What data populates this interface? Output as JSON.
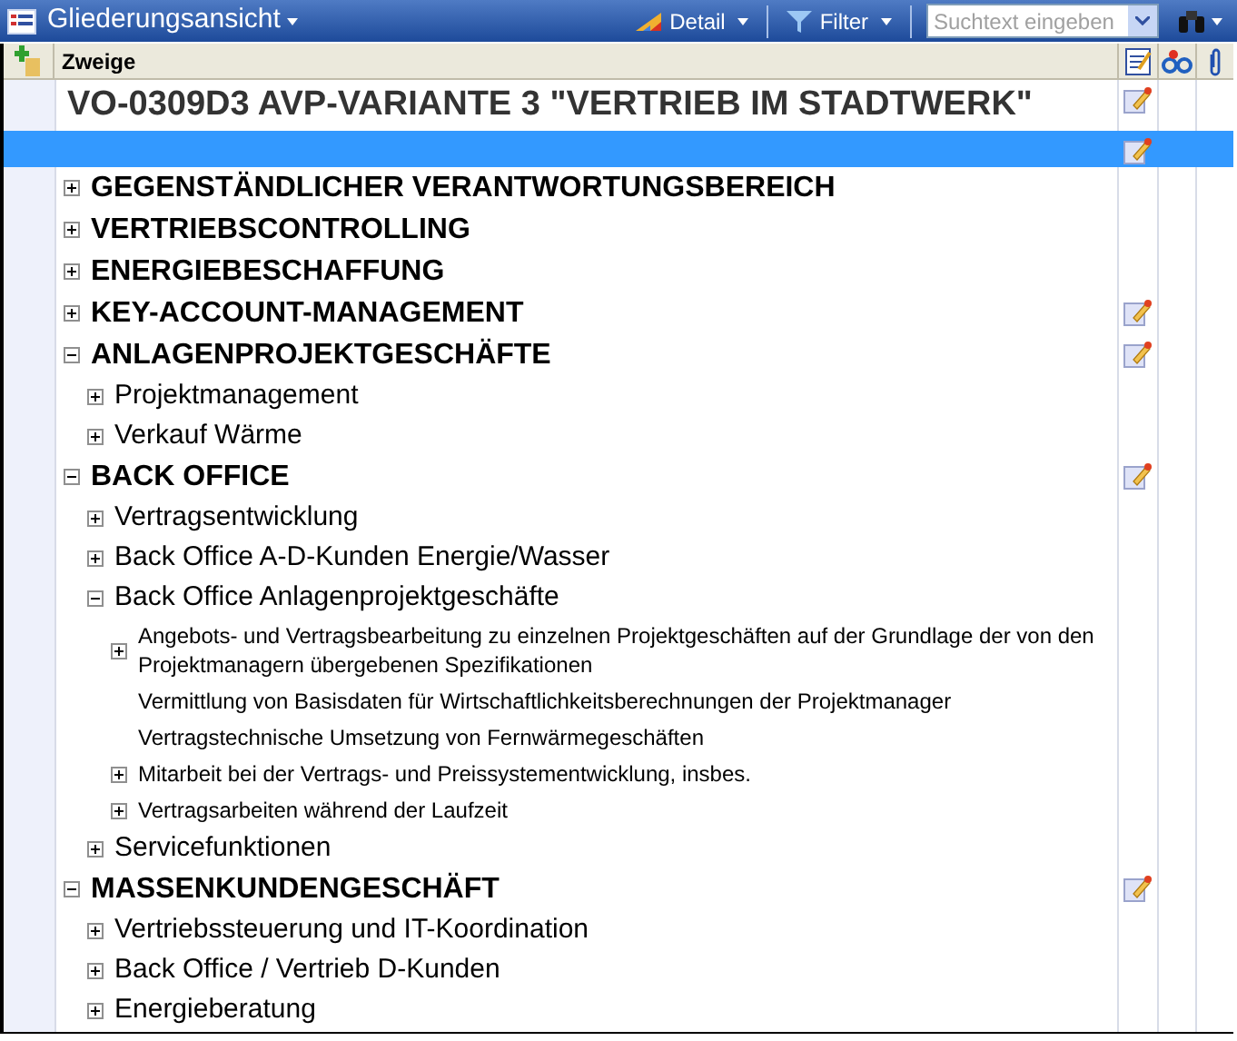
{
  "toolbar": {
    "title": "Gliederungsansicht",
    "detail": "Detail",
    "filter": "Filter",
    "search": {
      "placeholder": "Suchtext eingeben"
    }
  },
  "header": {
    "column": "Zweige"
  },
  "rows": [
    {
      "kind": "title",
      "text": "VO-0309D3 AVP-VARIANTE 3 \"VERTRIEB IM STADTWERK\"",
      "selected": false,
      "has_note": true
    },
    {
      "kind": "blank",
      "selected": true,
      "has_note": true
    }
  ],
  "tree": [
    {
      "kind": "branch",
      "text": "GEGENSTÄNDLICHER VERANTWORTUNGSBEREICH",
      "expanded": false,
      "has_note": false
    },
    {
      "kind": "branch",
      "text": "VERTRIEBSCONTROLLING",
      "expanded": false,
      "has_note": false
    },
    {
      "kind": "branch",
      "text": "ENERGIEBESCHAFFUNG",
      "expanded": false,
      "has_note": false
    },
    {
      "kind": "branch",
      "text": "KEY-ACCOUNT-MANAGEMENT",
      "expanded": false,
      "has_note": true
    },
    {
      "kind": "branch",
      "text": "ANLAGENPROJEKTGESCHÄFTE",
      "expanded": true,
      "has_note": true,
      "children": [
        {
          "kind": "branch",
          "text": "Projektmanagement",
          "expanded": false,
          "has_note": false
        },
        {
          "kind": "branch",
          "text": "Verkauf Wärme",
          "expanded": false,
          "has_note": false
        }
      ]
    },
    {
      "kind": "branch",
      "text": "BACK OFFICE",
      "expanded": true,
      "has_note": true,
      "children": [
        {
          "kind": "branch",
          "text": "Vertragsentwicklung",
          "expanded": false,
          "has_note": false
        },
        {
          "kind": "branch",
          "text": "Back Office A-D-Kunden Energie/Wasser",
          "expanded": false,
          "has_note": false
        },
        {
          "kind": "branch",
          "text": "Back Office Anlagenprojektgeschäfte",
          "expanded": true,
          "has_note": false,
          "children": [
            {
              "kind": "branch",
              "text": "Angebots- und Vertragsbearbeitung zu einzelnen Projektgeschäften auf der Grundlage der von den Projektmanagern übergebenen Spezifikationen",
              "expanded": false,
              "has_note": false
            },
            {
              "kind": "leaf",
              "text": "Vermittlung von Basisdaten für Wirtschaftlichkeitsberechnungen der Projektmanager",
              "has_note": false
            },
            {
              "kind": "leaf",
              "text": "Vertragstechnische Umsetzung von Fernwärmegeschäften",
              "has_note": false
            },
            {
              "kind": "branch",
              "text": "Mitarbeit bei der Vertrags- und Preissystementwicklung, insbes.",
              "expanded": false,
              "has_note": false
            },
            {
              "kind": "branch",
              "text": "Vertragsarbeiten während der Laufzeit",
              "expanded": false,
              "has_note": false
            }
          ]
        },
        {
          "kind": "branch",
          "text": "Servicefunktionen",
          "expanded": false,
          "has_note": false
        }
      ]
    },
    {
      "kind": "branch",
      "text": "MASSENKUNDENGESCHÄFT",
      "expanded": true,
      "has_note": true,
      "children": [
        {
          "kind": "branch",
          "text": "Vertriebssteuerung und IT-Koordination",
          "expanded": false,
          "has_note": false
        },
        {
          "kind": "branch",
          "text": "Back Office / Vertrieb D-Kunden",
          "expanded": false,
          "has_note": false
        },
        {
          "kind": "branch",
          "text": "Energieberatung",
          "expanded": false,
          "has_note": false
        }
      ]
    }
  ]
}
